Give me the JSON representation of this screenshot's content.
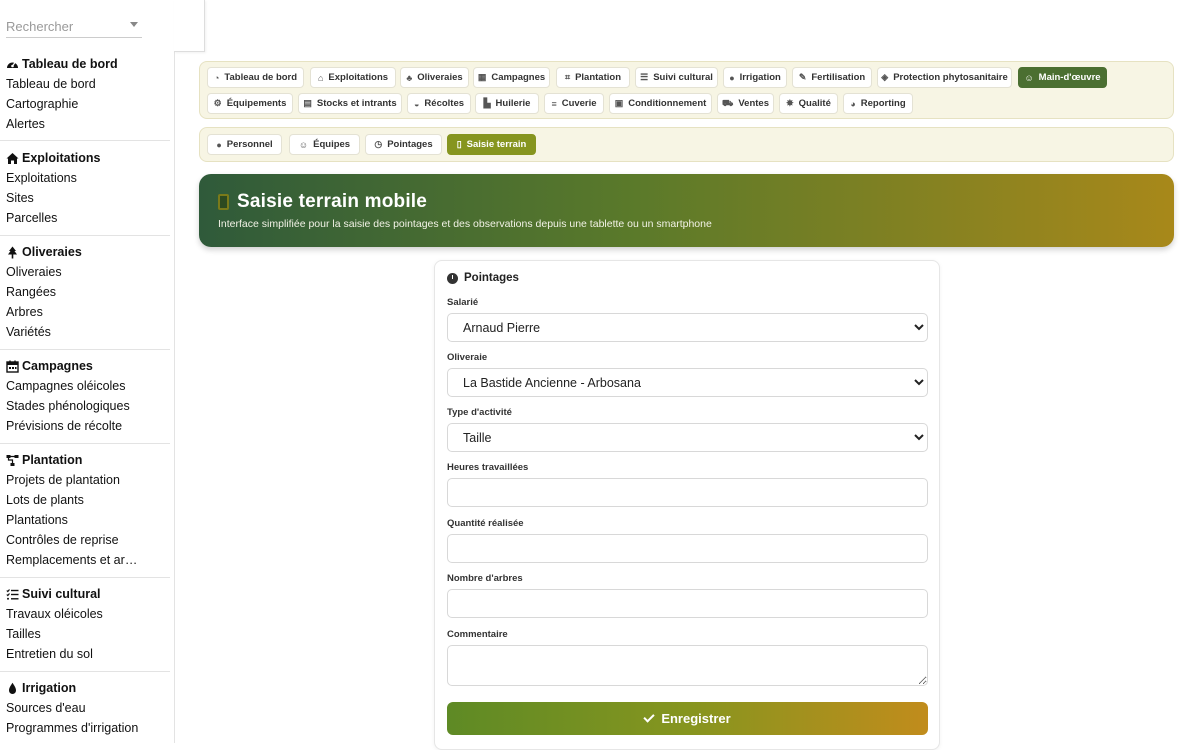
{
  "search": {
    "placeholder": "Rechercher"
  },
  "sidebar": {
    "sections": [
      {
        "title": "Tableau de bord",
        "icon": "gauge-icon",
        "items": [
          "Tableau de bord",
          "Cartographie",
          "Alertes"
        ]
      },
      {
        "title": "Exploitations",
        "icon": "home-icon",
        "items": [
          "Exploitations",
          "Sites",
          "Parcelles"
        ]
      },
      {
        "title": "Oliveraies",
        "icon": "tree-icon",
        "items": [
          "Oliveraies",
          "Rangées",
          "Arbres",
          "Variétés"
        ]
      },
      {
        "title": "Campagnes",
        "icon": "calendar-icon",
        "items": [
          "Campagnes oléicoles",
          "Stades phénologiques",
          "Prévisions de récolte"
        ]
      },
      {
        "title": "Plantation",
        "icon": "sitemap-icon",
        "items": [
          "Projets de plantation",
          "Lots de plants",
          "Plantations",
          "Contrôles de reprise",
          "Remplacements et arrachages"
        ]
      },
      {
        "title": "Suivi cultural",
        "icon": "list-icon",
        "items": [
          "Travaux oléicoles",
          "Tailles",
          "Entretien du sol"
        ]
      },
      {
        "title": "Irrigation",
        "icon": "drop-icon",
        "items": [
          "Sources d'eau",
          "Programmes d'irrigation"
        ]
      }
    ]
  },
  "nav_main": [
    {
      "label": "Tableau de bord",
      "icon": "gauge-icon",
      "glyph": "◔"
    },
    {
      "label": "Exploitations",
      "icon": "home-icon",
      "glyph": "⌂"
    },
    {
      "label": "Oliveraies",
      "icon": "tree-icon",
      "glyph": "♣"
    },
    {
      "label": "Campagnes",
      "icon": "calendar-icon",
      "glyph": "▦"
    },
    {
      "label": "Plantation",
      "icon": "sitemap-icon",
      "glyph": "⌗"
    },
    {
      "label": "Suivi cultural",
      "icon": "list-icon",
      "glyph": "☰"
    },
    {
      "label": "Irrigation",
      "icon": "drop-icon",
      "glyph": "●"
    },
    {
      "label": "Fertilisation",
      "icon": "spray-icon",
      "glyph": "✎"
    },
    {
      "label": "Protection phytosanitaire",
      "icon": "shield-icon",
      "glyph": "◈"
    },
    {
      "label": "Main-d'œuvre",
      "icon": "users-icon",
      "glyph": "☺",
      "active": true
    },
    {
      "label": "Équipements",
      "icon": "tractor-icon",
      "glyph": "⚙"
    },
    {
      "label": "Stocks et intrants",
      "icon": "boxes-icon",
      "glyph": "▤"
    },
    {
      "label": "Récoltes",
      "icon": "basket-icon",
      "glyph": "◒"
    },
    {
      "label": "Huilerie",
      "icon": "industry-icon",
      "glyph": "▙"
    },
    {
      "label": "Cuverie",
      "icon": "database-icon",
      "glyph": "≡"
    },
    {
      "label": "Conditionnement",
      "icon": "packages-icon",
      "glyph": "▣"
    },
    {
      "label": "Ventes",
      "icon": "cart-icon",
      "glyph": "⛟"
    },
    {
      "label": "Qualité",
      "icon": "certificate-icon",
      "glyph": "✸"
    },
    {
      "label": "Reporting",
      "icon": "chart-pie-icon",
      "glyph": "◕"
    }
  ],
  "nav_sub": [
    {
      "label": "Personnel",
      "icon": "user-icon",
      "glyph": "●"
    },
    {
      "label": "Équipes",
      "icon": "users-icon",
      "glyph": "☺"
    },
    {
      "label": "Pointages",
      "icon": "clock-icon",
      "glyph": "◷"
    },
    {
      "label": "Saisie terrain",
      "icon": "mobile-icon",
      "glyph": "▯",
      "active": true
    }
  ],
  "hero": {
    "title": "Saisie terrain mobile",
    "subtitle": "Interface simplifiée pour la saisie des pointages et des observations depuis une tablette ou un smartphone"
  },
  "form": {
    "title": "Pointages",
    "salarie_label": "Salarié",
    "salarie_value": "Arnaud Pierre",
    "oliveraie_label": "Oliveraie",
    "oliveraie_value": "La Bastide Ancienne - Arbosana",
    "activite_label": "Type d'activité",
    "activite_value": "Taille",
    "heures_label": "Heures travaillées",
    "quantite_label": "Quantité réalisée",
    "arbres_label": "Nombre d'arbres",
    "commentaire_label": "Commentaire",
    "save_label": "Enregistrer"
  },
  "colors": {
    "accent": "#4b6f31",
    "accent_light": "#86951f",
    "gold": "#c18c1c"
  }
}
